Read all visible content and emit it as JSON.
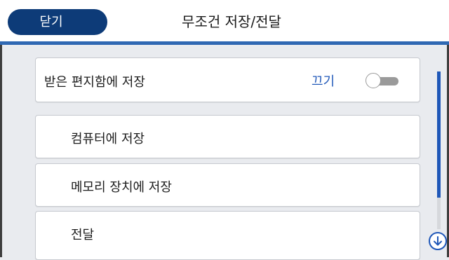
{
  "header": {
    "close_label": "닫기",
    "title": "무조건 저장/전달"
  },
  "inbox_setting": {
    "label": "받은 편지함에 저장",
    "state_label": "끄기",
    "enabled": false
  },
  "menu": {
    "items": [
      {
        "label": "컴퓨터에 저장"
      },
      {
        "label": "메모리 장치에 저장"
      },
      {
        "label": "전달"
      }
    ]
  },
  "icons": {
    "scroll_down": "arrow-down-circle-icon"
  },
  "colors": {
    "primary": "#0d3b78",
    "accent": "#1f57b8",
    "background": "#e9ebef"
  }
}
